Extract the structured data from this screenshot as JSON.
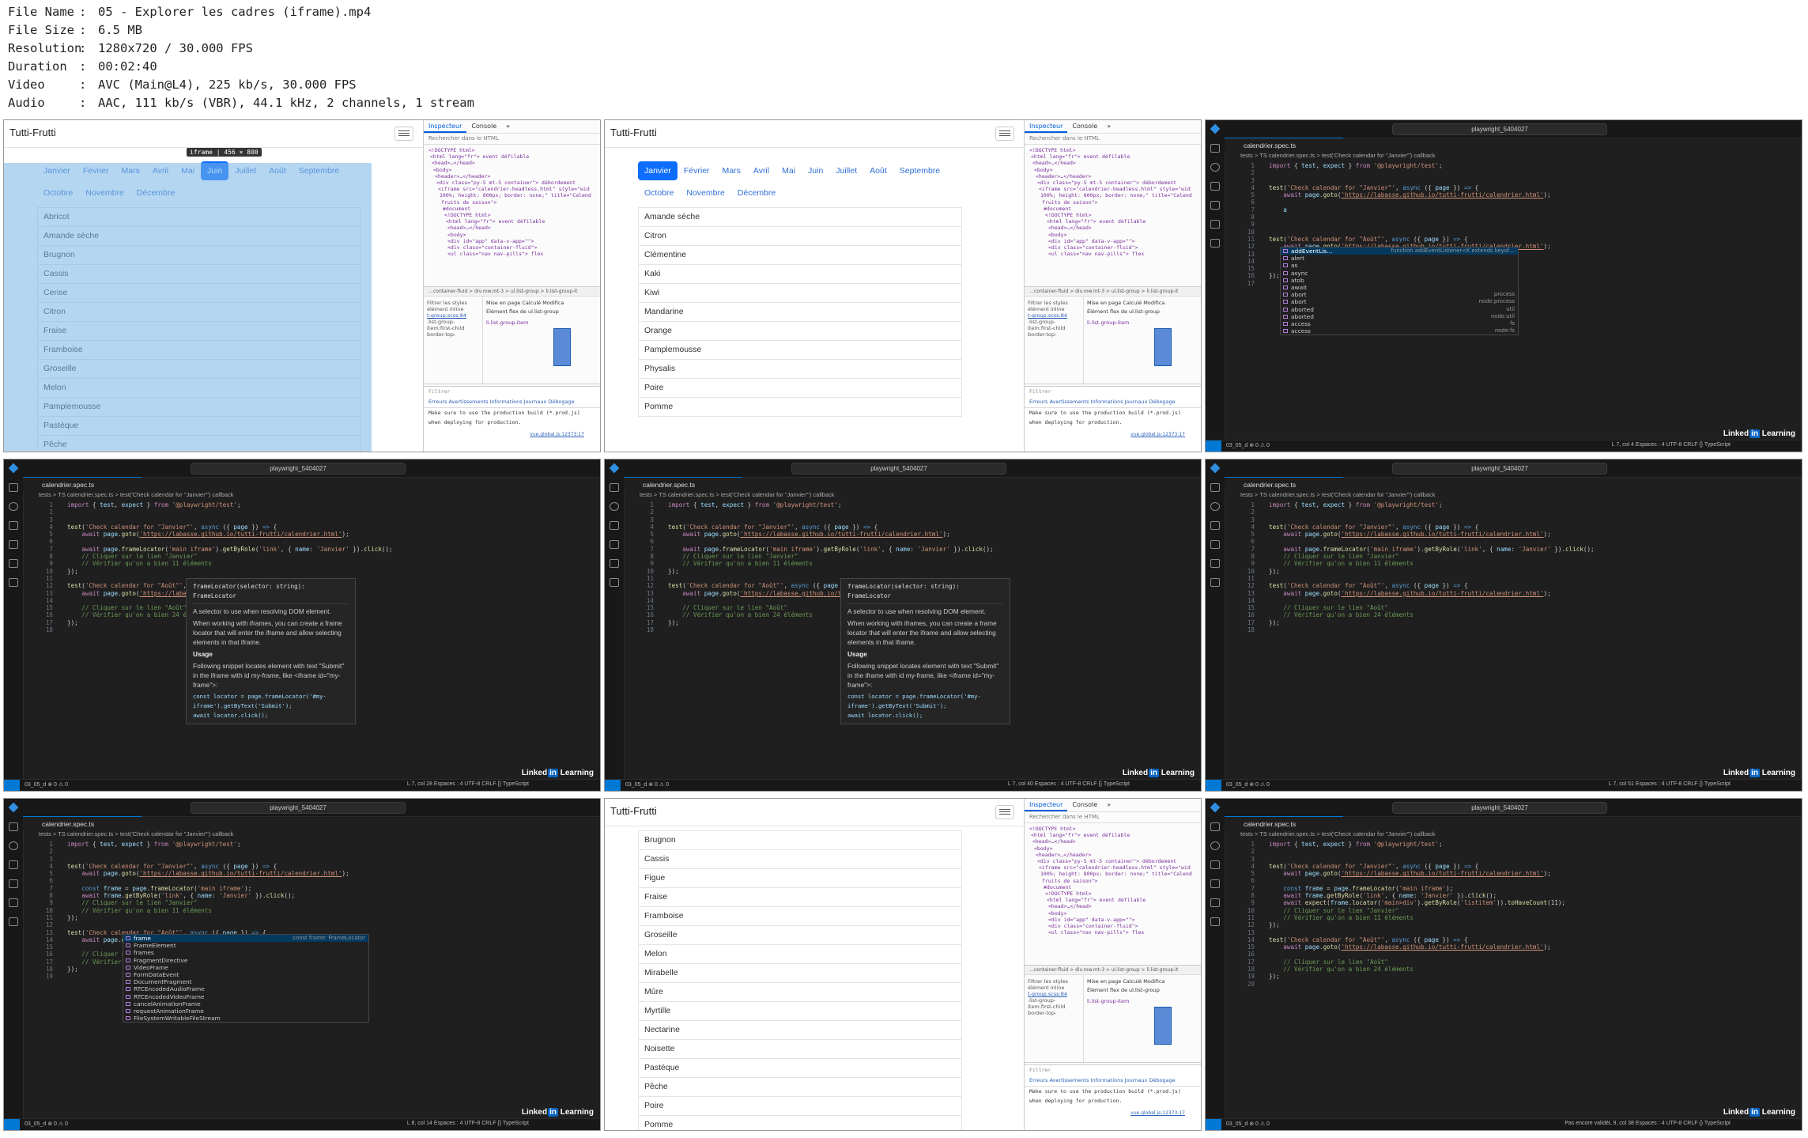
{
  "meta": [
    {
      "k": "File Name",
      "v": "05 - Explorer les cadres (iframe).mp4"
    },
    {
      "k": "File Size",
      "v": "6.5 MB"
    },
    {
      "k": "Resolution",
      "v": "1280x720 / 30.000 FPS"
    },
    {
      "k": "Duration",
      "v": "00:02:40"
    },
    {
      "k": "Video",
      "v": "AVC (Main@L4), 225 kb/s, 30.000 FPS"
    },
    {
      "k": "Audio",
      "v": "AAC, 111 kb/s (VBR), 44.1 kHz, 2 channels, 1 stream"
    }
  ],
  "browser": {
    "title": "Tutti-Frutti",
    "tooltip": "iframe | 456 × 800",
    "months": [
      "Janvier",
      "Février",
      "Mars",
      "Avril",
      "Mai",
      "Juin",
      "Juillet",
      "Août",
      "Septembre",
      "Octobre",
      "Novembre",
      "Décembre"
    ],
    "fruits_juin": [
      "Abricot",
      "Amande sèche",
      "Brugnon",
      "Cassis",
      "Cerise",
      "Citron",
      "Fraise",
      "Framboise",
      "Groseille",
      "Melon",
      "Pamplemousse",
      "Pastèque",
      "Pêche"
    ],
    "fruits_janvier": [
      "Amande sèche",
      "Citron",
      "Clémentine",
      "Kaki",
      "Kiwi",
      "Mandarine",
      "Orange",
      "Pamplemousse",
      "Physalis",
      "Poire",
      "Pomme"
    ],
    "fruits_aout": [
      "Brugnon",
      "Cassis",
      "Figue",
      "Fraise",
      "Framboise",
      "Groseille",
      "Melon",
      "Mirabelle",
      "Mûre",
      "Myrtille",
      "Nectarine",
      "Noisette",
      "Pastèque",
      "Pêche",
      "Poire",
      "Pomme"
    ]
  },
  "devtools": {
    "tabs": [
      "Inspecteur",
      "Console",
      "»"
    ],
    "search": "Rechercher dans le HTML",
    "dom": [
      "<!DOCTYPE html>",
      "<html lang=\"fr\"> event défilable",
      "<head>…</head>",
      "<body>",
      "<header>…</header>",
      "<div class=\"py-5 mt-5 container\"> débordement",
      "<iframe src=\"calendrier-headless.html\" style=\"wid",
      "100%; height: 800px; border: none;\" title=\"Calend",
      "fruits de saison\">",
      "#document",
      "<!DOCTYPE html>",
      "<html lang=\"fr\"> event défilable",
      "<head>…</head>",
      "<body>",
      "<div id=\"app\" data-v-app=\"\">",
      "<div class=\"container-fluid\">",
      "<ul class=\"nav nav-pills\"> flex"
    ],
    "crumb": "…container-fluid > div.row.mt-3 > ul.list-group > li.list-group-it",
    "filter": "Filtrer les styles",
    "layout_tabs": "Mise en page   Calculé   Modifica",
    "flex_label": "Élément flex de ul.list-group",
    "flex_item": "li.list-group-item",
    "rules": [
      "élément  inline",
      "t-group.scss:84",
      ".list-group-",
      "item:first-child",
      "border-top-"
    ],
    "console_tabs": "Erreurs  Avertissements  Informations  Journaux  Débogage",
    "console_filter": "Filtrer",
    "console_msg1": "Make sure to use the production build (*.prod.js)",
    "console_msg2": "when deploying for production.",
    "console_link": "vue.global.js:12373:17"
  },
  "vscode": {
    "search": "playwright_5404027",
    "tab": "calendrier.spec.ts",
    "crumb": "tests > TS calendrier.spec.ts > test('Check calendar for \"Janvier\"') callback",
    "status_branch": "03_05_d",
    "status_problems": "⊗ 0 ⚠ 0",
    "status_right": "Espaces : 4   UTF-8   CRLF   {} TypeScript",
    "status_not_validated": "Pas encore validé",
    "pos1": "L 7, col 4",
    "pos2": "L 7, col 28",
    "pos3": "L 7, col 40",
    "pos4": "L 7, col 51",
    "pos5": "L 8, col 14",
    "pos6": "L 9, col 38",
    "brand": "Linked",
    "brand_in": "in",
    "brand_tail": "Learning"
  },
  "code": {
    "l1": "import { test, expect } from '@playwright/test';",
    "test_jan": "test('Check calendar for \"Janvier\"', async ({ page }) => {",
    "goto": "await page.goto('https://labasse.github.io/tutti-frutti/calendrier.html');",
    "test_aout": "test('Check calendar for \"Août\"', async ({ page }) => {",
    "c_jan": "// Cliquer sur le lien \"Janvier\"",
    "c_11": "// Vérifier qu'on a bien 11 éléments",
    "c_aout": "// Cliquer sur le lien \"Août\"",
    "c_24": "// Vérifier qu'on a bien 24 éléments",
    "end": "});",
    "typed_a": "a",
    "fl_line": "await page.frameLocator('main iframe').getByRole('link', { name: 'Janvier' }).click();",
    "const_frame": "const frame = page.frameLocator('main iframe');",
    "frame_click": "await frame.getByRole('link', { name: 'Janvier' }).click();",
    "expect_line": "await expect(frame.locator('main>div').getByRole('listitem')).toHaveCount(11);"
  },
  "hover": {
    "sig": "frameLocator(selector: string): FrameLocator",
    "p1": "A selector to use when resolving DOM element.",
    "p2": "When working with iframes, you can create a frame locator that will enter the iframe and allow selecting elements in that iframe.",
    "usage": "Usage",
    "p3": "Following snippet locates element with text \"Submit\" in the iframe with id my-frame, like <iframe id=\"my-frame\">:",
    "code1": "const locator = page.frameLocator('#my-",
    "code2": "iframe').getByText('Submit');",
    "code3": "await locator.click();"
  },
  "suggest_a": {
    "detail": "function addEventListener<K extends keyof…",
    "items": [
      {
        "label": "addEventLis…",
        "det": ""
      },
      {
        "label": "alert",
        "det": ""
      },
      {
        "label": "as",
        "det": ""
      },
      {
        "label": "async",
        "det": ""
      },
      {
        "label": "atob",
        "det": ""
      },
      {
        "label": "await",
        "det": ""
      },
      {
        "label": "abort",
        "det": "process"
      },
      {
        "label": "abort",
        "det": "node:process"
      },
      {
        "label": "aborted",
        "det": "util"
      },
      {
        "label": "aborted",
        "det": "node:util"
      },
      {
        "label": "access",
        "det": "fs"
      },
      {
        "label": "access",
        "det": "node:fs"
      }
    ]
  },
  "suggest_frame": {
    "detail": "const frame: FrameLocator",
    "items": [
      {
        "label": "frame",
        "det": ""
      },
      {
        "label": "FrameElement",
        "det": ""
      },
      {
        "label": "frames",
        "det": ""
      },
      {
        "label": "FragmentDirective",
        "det": ""
      },
      {
        "label": "VideoFrame",
        "det": ""
      },
      {
        "label": "FormDataEvent",
        "det": ""
      },
      {
        "label": "DocumentFragment",
        "det": ""
      },
      {
        "label": "RTCEncodedAudioFrame",
        "det": ""
      },
      {
        "label": "RTCEncodedVideoFrame",
        "det": ""
      },
      {
        "label": "cancelAnimationFrame",
        "det": ""
      },
      {
        "label": "requestAnimationFrame",
        "det": ""
      },
      {
        "label": "FileSystemWritableFileStream",
        "det": ""
      }
    ]
  }
}
